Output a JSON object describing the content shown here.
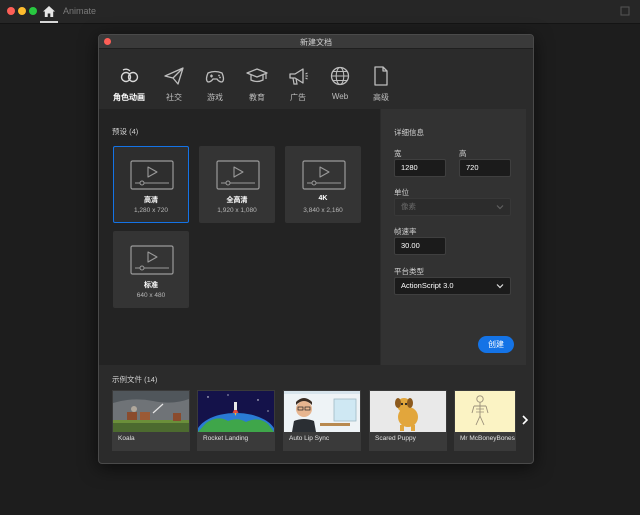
{
  "app": {
    "title": "Animate"
  },
  "dialog": {
    "title": "新建文档",
    "tabs": [
      {
        "label": "角色动画",
        "icon": "character-animation-icon"
      },
      {
        "label": "社交",
        "icon": "paper-plane-icon"
      },
      {
        "label": "游戏",
        "icon": "gamepad-icon"
      },
      {
        "label": "教育",
        "icon": "graduation-cap-icon"
      },
      {
        "label": "广告",
        "icon": "megaphone-icon"
      },
      {
        "label": "Web",
        "icon": "globe-icon"
      },
      {
        "label": "高级",
        "icon": "document-icon"
      }
    ],
    "active_tab": 0
  },
  "presets": {
    "label": "预设 (4)",
    "items": [
      {
        "name": "高清",
        "size": "1,280 x 720"
      },
      {
        "name": "全高清",
        "size": "1,920 x 1,080"
      },
      {
        "name": "4K",
        "size": "3,840 x 2,160"
      },
      {
        "name": "标准",
        "size": "640 x 480"
      }
    ],
    "selected": 0
  },
  "details": {
    "heading": "详细信息",
    "width_label": "宽",
    "width_value": "1280",
    "height_label": "高",
    "height_value": "720",
    "units_label": "单位",
    "units_value": "像素",
    "fps_label": "帧速率",
    "fps_value": "30.00",
    "platform_label": "平台类型",
    "platform_value": "ActionScript 3.0",
    "create_label": "创建"
  },
  "samples": {
    "label": "示例文件 (14)",
    "items": [
      {
        "caption": "Koala"
      },
      {
        "caption": "Rocket Landing"
      },
      {
        "caption": "Auto Lip Sync"
      },
      {
        "caption": "Scared Puppy"
      },
      {
        "caption": "Mr McBoneyBones"
      }
    ]
  },
  "colors": {
    "accent": "#1473e6",
    "dialog_bg": "#2b2b2b",
    "panel_dark": "#232323",
    "panel_light": "#323232"
  }
}
